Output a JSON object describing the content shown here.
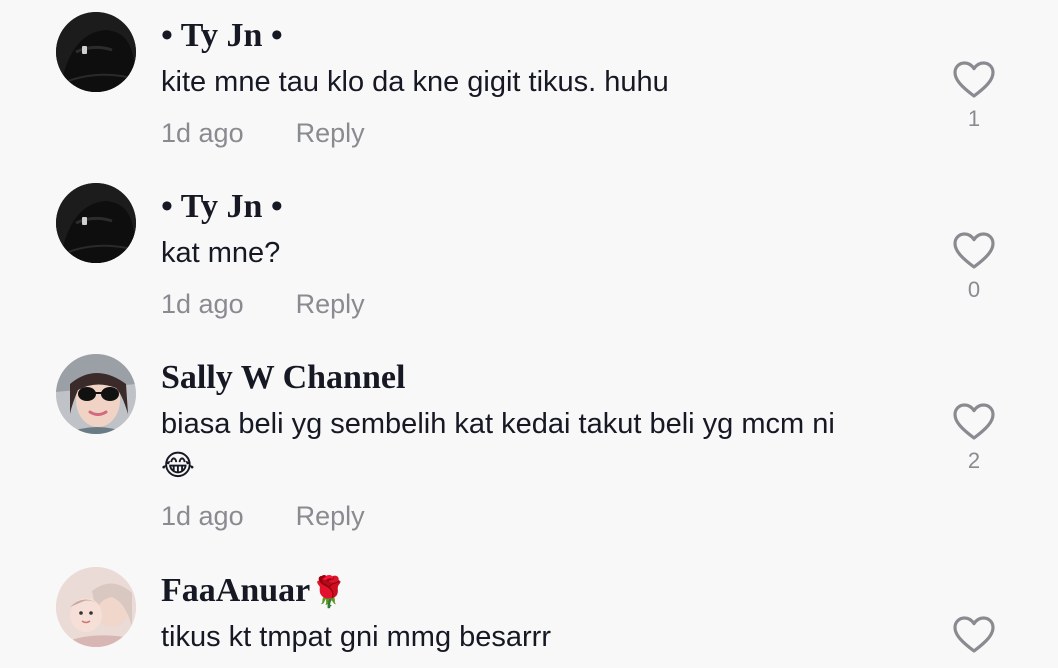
{
  "comments": [
    {
      "username": "• Ty Jn •",
      "text": "kite mne tau klo da kne gigit tikus. huhu",
      "time": "1d ago",
      "reply": "Reply",
      "likes": "1",
      "avatar_icon": "dark-bag-avatar"
    },
    {
      "username": "• Ty Jn •",
      "text": "kat mne?",
      "time": "1d ago",
      "reply": "Reply",
      "likes": "0",
      "avatar_icon": "dark-bag-avatar"
    },
    {
      "username": "Sally W Channel",
      "text": "biasa beli yg sembelih kat kedai takut beli yg mcm ni",
      "emoji": "😂",
      "time": "1d ago",
      "reply": "Reply",
      "likes": "2",
      "avatar_icon": "woman-sunglasses-avatar"
    },
    {
      "username": "FaaAnuar",
      "username_emoji": "🌹",
      "text": "tikus kt tmpat gni mmg besarrr",
      "avatar_icon": "mother-baby-avatar"
    }
  ],
  "colors": {
    "background": "#f8f8f8",
    "text": "#161823",
    "muted": "#8a8b91",
    "heart_outline": "#8a8b91"
  }
}
